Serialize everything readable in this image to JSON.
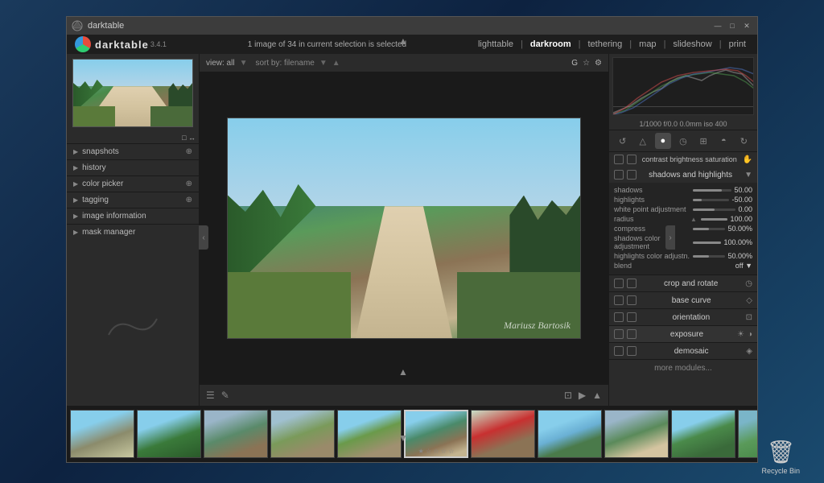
{
  "window": {
    "title": "darktable",
    "version": "3.4.1"
  },
  "menu": {
    "center_info": "1 image of 34 in current selection is selected",
    "nav_links": [
      {
        "id": "lighttable",
        "label": "lighttable",
        "active": false
      },
      {
        "id": "darkroom",
        "label": "darkroom",
        "active": true
      },
      {
        "id": "tethering",
        "label": "tethering",
        "active": false
      },
      {
        "id": "map",
        "label": "map",
        "active": false
      },
      {
        "id": "slideshow",
        "label": "slideshow",
        "active": false
      },
      {
        "id": "print",
        "label": "print",
        "active": false
      }
    ]
  },
  "image_toolbar": {
    "view_label": "view: all",
    "sort_label": "sort by: filename",
    "rating": "G"
  },
  "left_sidebar": {
    "sections": [
      {
        "id": "snapshots",
        "label": "snapshots",
        "has_add": true
      },
      {
        "id": "history",
        "label": "history"
      },
      {
        "id": "color_picker",
        "label": "color picker",
        "has_add": true
      },
      {
        "id": "tagging",
        "label": "tagging",
        "has_add": true
      },
      {
        "id": "image_information",
        "label": "image information"
      },
      {
        "id": "mask_manager",
        "label": "mask manager"
      }
    ]
  },
  "exposure_info": "1/1000  f/0.0  0.0mm  iso 400",
  "module_icons": [
    {
      "id": "reset",
      "symbol": "↺",
      "active": false
    },
    {
      "id": "presets",
      "symbol": "◧",
      "active": false
    },
    {
      "id": "favorited",
      "symbol": "☆",
      "active": true
    },
    {
      "id": "all",
      "symbol": "●",
      "active": false
    },
    {
      "id": "history2",
      "symbol": "⊞",
      "active": false
    },
    {
      "id": "search",
      "symbol": "↻",
      "active": false
    },
    {
      "id": "correct",
      "symbol": "◓",
      "active": false
    }
  ],
  "active_module": {
    "controls": [
      "⚡",
      "△",
      "◐",
      "↺",
      "◷"
    ],
    "label1": "contrast brightness saturation",
    "label2": "shadows and highlights"
  },
  "module_params": {
    "header_toggles": [
      "■",
      "◎"
    ],
    "shadows": {
      "label": "shadows",
      "value": "50.00",
      "pct": 75
    },
    "highlights": {
      "label": "highlights",
      "value": "-50.00",
      "pct": 25
    },
    "whitepoint": {
      "label": "white point adjustment",
      "value": "0.00",
      "pct": 50
    },
    "radius": {
      "label": "radius",
      "value": "100.00",
      "pct": 100
    },
    "compress": {
      "label": "compress",
      "value": "50.00%",
      "pct": 50
    },
    "shadows_color": {
      "label": "shadows color adjustment",
      "value": "100.00%",
      "pct": 100
    },
    "highlights_color": {
      "label": "highlights color adjustn.",
      "value": "50.00%",
      "pct": 50
    },
    "blend": {
      "label": "blend",
      "value": "off ▼"
    }
  },
  "sub_modules": [
    {
      "id": "crop_rotate",
      "label": "crop and rotate",
      "icon": "◷"
    },
    {
      "id": "base_curve",
      "label": "base curve",
      "icon": "◇"
    },
    {
      "id": "orientation",
      "label": "orientation",
      "icon": "⊡"
    },
    {
      "id": "exposure",
      "label": "exposure",
      "icon": "☀",
      "active": true
    },
    {
      "id": "demosaic",
      "label": "demosaic",
      "icon": "◈"
    }
  ],
  "more_modules": "more modules...",
  "film_strip": {
    "thumbs": [
      {
        "id": 1,
        "class": "t1"
      },
      {
        "id": 2,
        "class": "t2"
      },
      {
        "id": 3,
        "class": "t3"
      },
      {
        "id": 4,
        "class": "t4"
      },
      {
        "id": 5,
        "class": "t5"
      },
      {
        "id": 6,
        "class": "t6",
        "active": true
      },
      {
        "id": 7,
        "class": "t7"
      },
      {
        "id": 8,
        "class": "t8"
      },
      {
        "id": 9,
        "class": "t9"
      },
      {
        "id": 10,
        "class": "t10"
      },
      {
        "id": 11,
        "class": "t11"
      }
    ]
  },
  "photo": {
    "watermark": "Mariusz Bartosik"
  },
  "recycle_bin": {
    "label": "Recycle Bin"
  }
}
